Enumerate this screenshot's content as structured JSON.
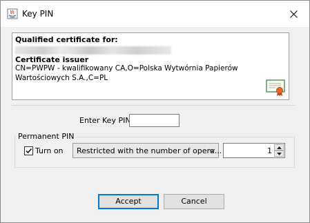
{
  "window": {
    "title": "Key PIN",
    "app_icon": "java-app-icon",
    "close_icon": "close-icon"
  },
  "certificate": {
    "qualified_heading": "Qualified certificate for:",
    "issuer_heading": "Certificate issuer",
    "issuer_line1": "CN=PWPW - kwalifikowany CA,O=Polska Wytwórnia Papierów",
    "issuer_line2": "Wartościowych S.A.,C=PL",
    "icon": "certificate-icon"
  },
  "pin": {
    "label": "Enter Key PIN",
    "value": ""
  },
  "permanent_pin": {
    "group_title": "Permanent PIN",
    "checkbox_label": "Turn on",
    "checkbox_checked": true,
    "select_value": "Restricted with the number of opera...",
    "spinner_value": "1"
  },
  "buttons": {
    "accept": "Accept",
    "cancel": "Cancel"
  }
}
